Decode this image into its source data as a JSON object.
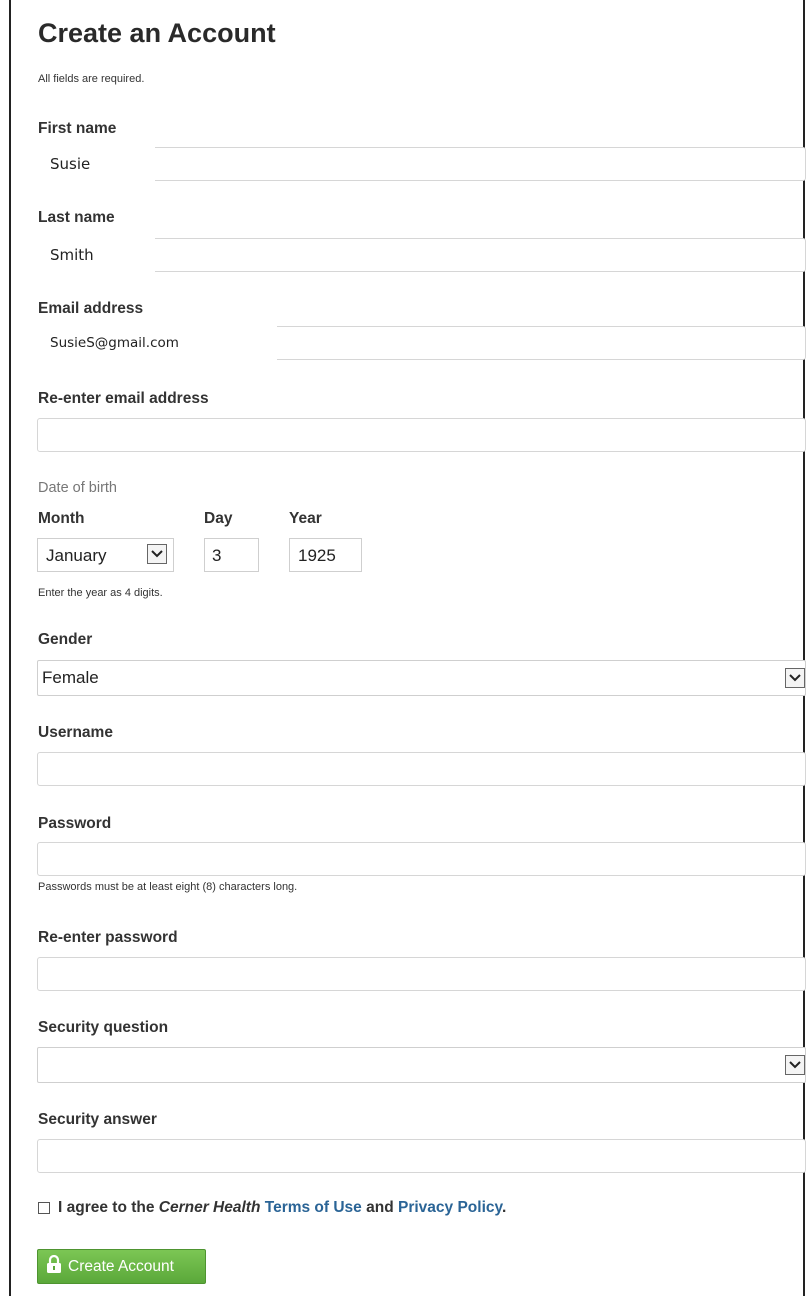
{
  "form": {
    "title": "Create an Account",
    "required_note": "All fields are required.",
    "first_name": {
      "label": "First name",
      "value": "Susie"
    },
    "last_name": {
      "label": "Last name",
      "value": "Smith"
    },
    "email": {
      "label": "Email address",
      "value": "SusieS@gmail.com"
    },
    "email_confirm": {
      "label": "Re-enter email address",
      "value": ""
    },
    "dob": {
      "label": "Date of birth",
      "month_label": "Month",
      "day_label": "Day",
      "year_label": "Year",
      "month_value": "January",
      "day_value": "3",
      "year_value": "1925",
      "hint": "Enter the year as 4 digits."
    },
    "gender": {
      "label": "Gender",
      "value": "Female"
    },
    "username": {
      "label": "Username",
      "value": ""
    },
    "password": {
      "label": "Password",
      "value": "",
      "hint": "Passwords must be at least eight (8) characters long."
    },
    "password_confirm": {
      "label": "Re-enter password",
      "value": ""
    },
    "security_question": {
      "label": "Security question",
      "value": ""
    },
    "security_answer": {
      "label": "Security answer",
      "value": ""
    },
    "agree": {
      "prefix": "I agree to the",
      "brand": "Cerner Health",
      "terms_link": "Terms of Use",
      "and": "and",
      "privacy_link": "Privacy Policy",
      "suffix": "."
    },
    "submit_label": "Create Account"
  },
  "colors": {
    "button_green": "#5ba83a",
    "link_blue": "#2a6496"
  },
  "icons": {
    "submit_icon": "lock-icon",
    "dropdown_icon": "chevron-down-icon"
  }
}
